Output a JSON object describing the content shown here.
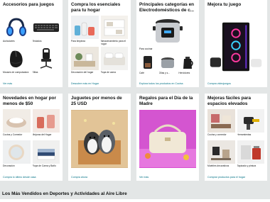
{
  "cards": [
    {
      "title": "Accesorios para juegos",
      "items": [
        "Auriculares",
        "Teclados",
        "Mouses de computadora",
        "Sillas"
      ],
      "link": "Ver más"
    },
    {
      "title": "Compra los esenciales para tu hogar",
      "items": [
        "Para limpieza",
        "Almacenamiento para el hogar",
        "Decoración del hogar",
        "Ropa de cama"
      ],
      "link": "Descubre más en Hogar"
    },
    {
      "title": "Principales categorías en Electrodomésticos de c...",
      "items": [
        "Para cocinar",
        "Café",
        "Ollas y s...",
        "Hervidores"
      ],
      "link": "Explora todos los productos en Cocina"
    },
    {
      "title": "Mejora tu juego",
      "link": "Compra videojuegos"
    },
    {
      "title": "Novedades en hogar por menos de $50",
      "items": [
        "Cocina y Comedor",
        "Mejoras del Hogar",
        "Decoración",
        "Ropa de Cama y Baño"
      ],
      "link": "Compra lo último desde casa"
    },
    {
      "title": "Juguetes por menos de 25 USD",
      "link": "Compra ahora"
    },
    {
      "title": "Regalos para el Día de la Madre",
      "link": "Ver más"
    },
    {
      "title": "Mejoras fáciles para espacios elevados",
      "items": [
        "Cocina y comedor",
        "Herramientas",
        "Muebles decorativos",
        "Tapizado y pintura"
      ],
      "link": "Comprar productos para el hogar"
    }
  ],
  "bottom_title": "Los Más Vendidos en Deportes y Actividades al Aire Libre",
  "colors": {
    "background": "#e3e6e6",
    "link": "#007185",
    "card": "#ffffff"
  }
}
